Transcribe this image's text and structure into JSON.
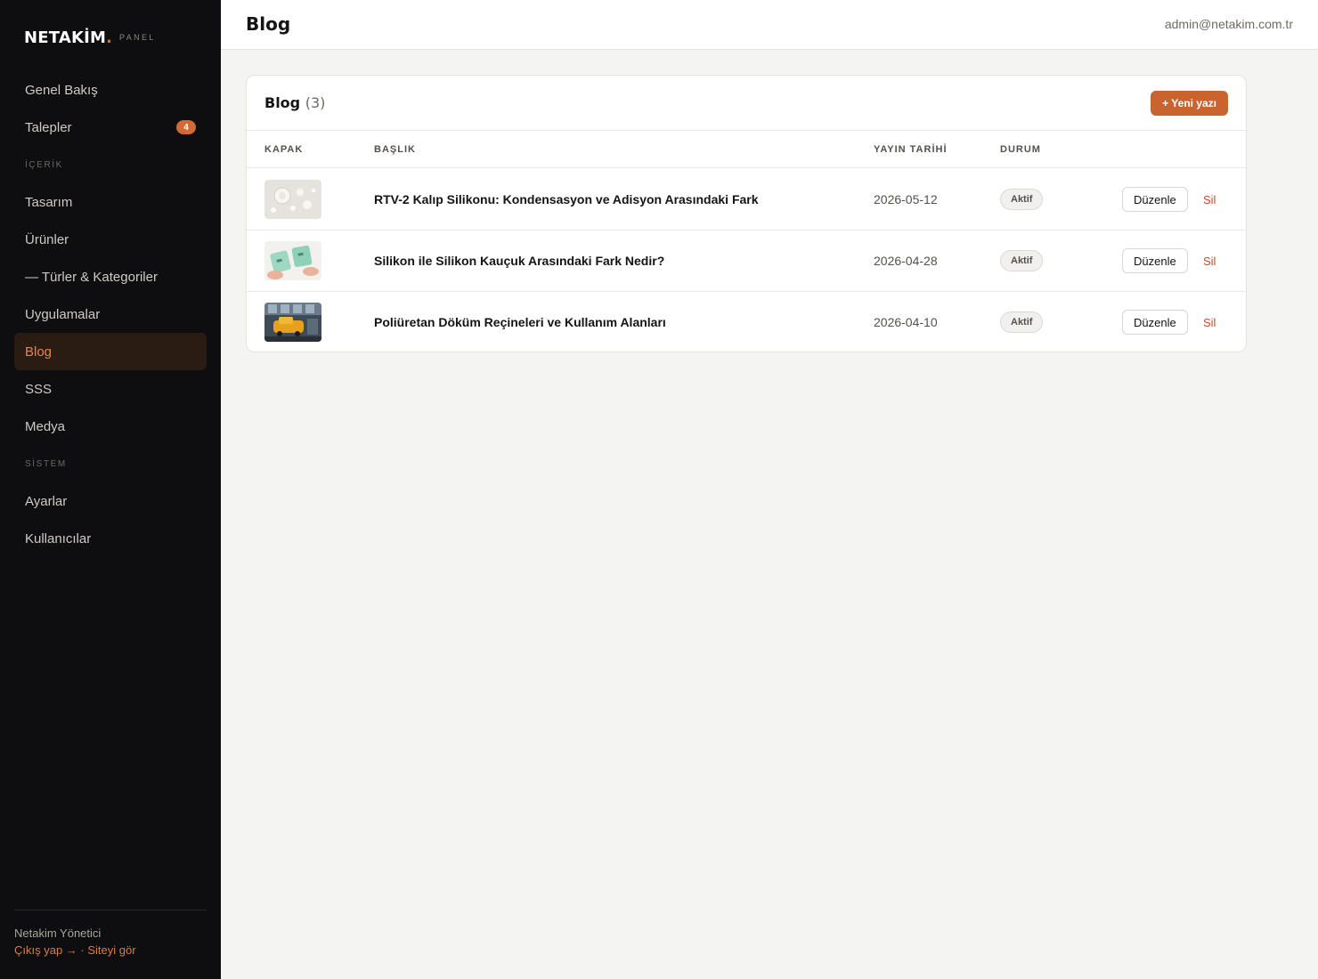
{
  "brand": {
    "name": "NETAKİM",
    "dot": ".",
    "sub": "PANEL"
  },
  "nav": {
    "items": [
      {
        "label": "Genel Bakış"
      },
      {
        "label": "Talepler",
        "badge": "4"
      }
    ],
    "content_section": "İÇERİK",
    "content_items": [
      {
        "label": "Tasarım"
      },
      {
        "label": "Ürünler"
      },
      {
        "label": "— Türler & Kategoriler"
      },
      {
        "label": "Uygulamalar"
      },
      {
        "label": "Blog",
        "active": true
      },
      {
        "label": "SSS"
      },
      {
        "label": "Medya"
      }
    ],
    "system_section": "SİSTEM",
    "system_items": [
      {
        "label": "Ayarlar"
      },
      {
        "label": "Kullanıcılar"
      }
    ]
  },
  "footer": {
    "user": "Netakim Yönetici",
    "logout": "Çıkış yap →",
    "separator": " · ",
    "view_site": "Siteyi gör"
  },
  "header": {
    "title": "Blog",
    "email": "admin@netakim.com.tr"
  },
  "card": {
    "title": "Blog",
    "count": "(3)",
    "new_button": "+ Yeni yazı"
  },
  "table": {
    "headers": {
      "cover": "KAPAK",
      "title": "BAŞLIK",
      "date": "YAYIN TARİHİ",
      "status": "DURUM"
    },
    "rows": [
      {
        "title": "RTV-2 Kalıp Silikonu: Kondensasyon ve Adisyon Arasındaki Fark",
        "date": "2026-05-12",
        "status": "Aktif",
        "edit": "Düzenle",
        "delete": "Sil"
      },
      {
        "title": "Silikon ile Silikon Kauçuk Arasındaki Fark Nedir?",
        "date": "2026-04-28",
        "status": "Aktif",
        "edit": "Düzenle",
        "delete": "Sil"
      },
      {
        "title": "Poliüretan Döküm Reçineleri ve Kullanım Alanları",
        "date": "2026-04-10",
        "status": "Aktif",
        "edit": "Düzenle",
        "delete": "Sil"
      }
    ]
  },
  "colors": {
    "accent": "#d26a35",
    "sidebar_bg": "#0e0e10",
    "delete": "#c44a2c"
  }
}
